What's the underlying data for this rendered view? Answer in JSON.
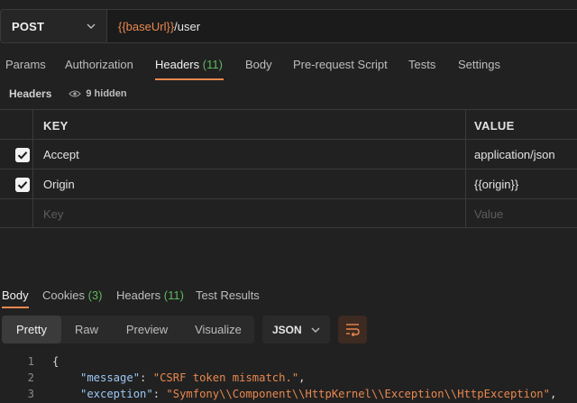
{
  "request": {
    "method": "POST",
    "url_var": "{{baseUrl}}",
    "url_path": "/user"
  },
  "request_tabs": [
    {
      "label": "Params"
    },
    {
      "label": "Authorization"
    },
    {
      "label": "Headers",
      "count": "(11)",
      "active": true
    },
    {
      "label": "Body"
    },
    {
      "label": "Pre-request Script"
    },
    {
      "label": "Tests"
    },
    {
      "label": "Settings"
    }
  ],
  "headers_section": {
    "title": "Headers",
    "hidden_text": "9 hidden"
  },
  "table": {
    "col_key": "KEY",
    "col_value": "VALUE",
    "rows": [
      {
        "key": "Accept",
        "value": "application/json",
        "checked": true
      },
      {
        "key": "Origin",
        "value": "{{origin}}",
        "checked": true
      }
    ],
    "new_row": {
      "key_placeholder": "Key",
      "value_placeholder": "Value"
    }
  },
  "response_tabs": [
    {
      "label": "Body",
      "active": true
    },
    {
      "label": "Cookies",
      "count": "(3)"
    },
    {
      "label": "Headers",
      "count": "(11)"
    },
    {
      "label": "Test Results"
    }
  ],
  "view_modes": [
    "Pretty",
    "Raw",
    "Preview",
    "Visualize"
  ],
  "format": "JSON",
  "code_lines": [
    {
      "n": "1",
      "text": "{"
    },
    {
      "n": "2",
      "key": "\"message\"",
      "value": "\"CSRF token mismatch.\""
    },
    {
      "n": "3",
      "key": "\"exception\"",
      "value": "\"Symfony\\\\Component\\\\HttpKernel\\\\Exception\\\\HttpException\""
    }
  ],
  "colors": {
    "accent": "#e8884f",
    "count_green": "#5fb85f",
    "json_key": "#9cc8f5"
  },
  "icons": [
    "chevron-down-icon",
    "eye-icon",
    "checkbox-checked-icon",
    "wrap-lines-icon"
  ]
}
